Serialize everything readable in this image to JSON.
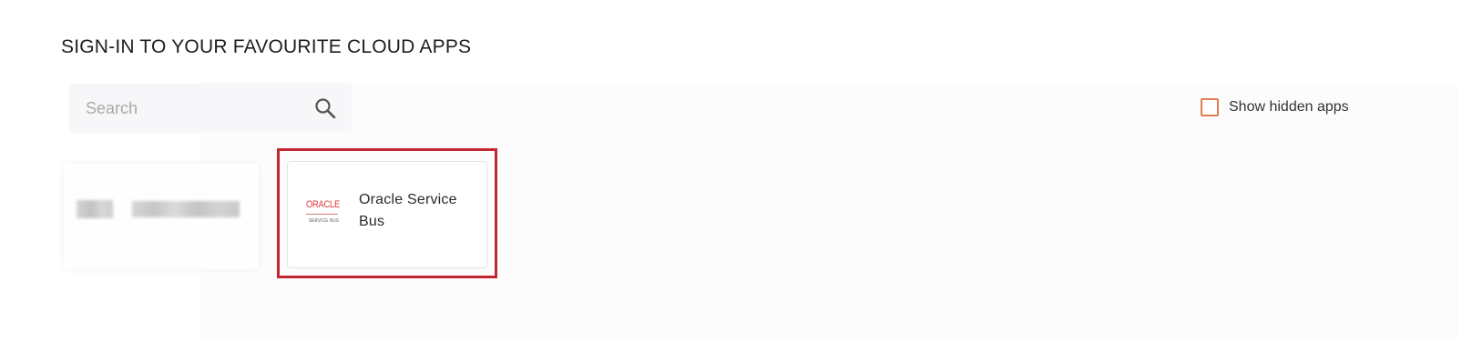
{
  "header": {
    "title": "SIGN-IN TO YOUR FAVOURITE CLOUD APPS"
  },
  "search": {
    "placeholder": "Search",
    "value": "",
    "icon": "search-icon"
  },
  "filters": {
    "show_hidden_label": "Show hidden apps",
    "show_hidden_checked": false,
    "checkbox_color": "#e07d52"
  },
  "apps": [
    {
      "name": "",
      "obscured": true
    },
    {
      "name": "Oracle Service Bus",
      "logo_text": "ORACLE",
      "logo_subtext": "SERVICE BUS",
      "logo_color": "#e03a3e",
      "highlighted": true
    }
  ],
  "colors": {
    "highlight_border": "#c32633"
  }
}
